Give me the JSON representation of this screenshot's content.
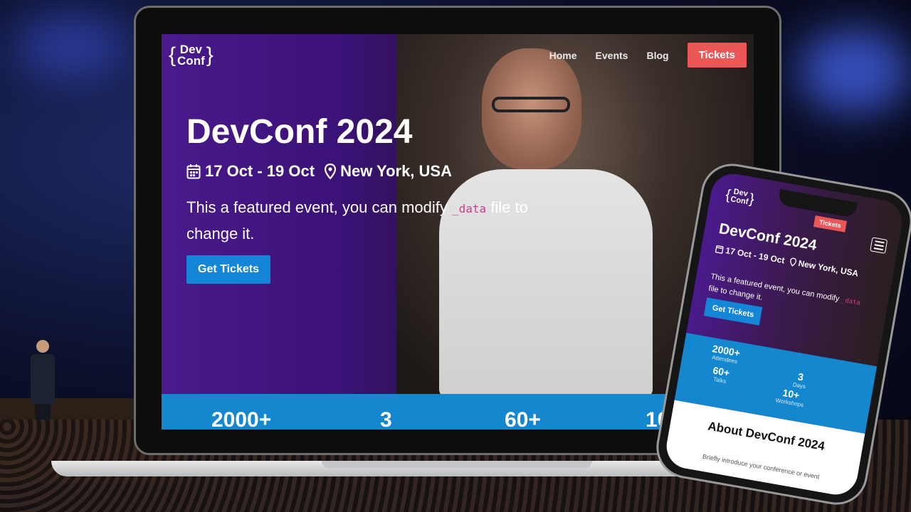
{
  "site": {
    "logo": {
      "line1": "Dev",
      "line2": "Conf",
      "brace_open": "{",
      "brace_close": "}"
    },
    "nav": {
      "home": "Home",
      "events": "Events",
      "blog": "Blog",
      "tickets": "Tickets"
    }
  },
  "hero": {
    "title": "DevConf 2024",
    "dates": "17 Oct - 19 Oct",
    "location": "New York, USA",
    "desc_before": "This a featured event, you can modify ",
    "desc_code": "_data",
    "desc_after": " file to change it.",
    "cta": "Get Tickets"
  },
  "stats": [
    {
      "value": "2000+",
      "label": "Attendees"
    },
    {
      "value": "3",
      "label": "Days"
    },
    {
      "value": "60+",
      "label": "Talks"
    },
    {
      "value": "10+",
      "label": "Workshops"
    }
  ],
  "about": {
    "title": "About DevConf 2024",
    "text": "Briefly introduce your conference or event"
  },
  "icons": {
    "calendar": "calendar-icon",
    "location": "map-pin-icon",
    "menu": "hamburger-menu-icon"
  },
  "colors": {
    "accent_red": "#eb5757",
    "accent_blue": "#1585d8",
    "stats_blue": "#1487cf",
    "code_pink": "#d03d8a",
    "hero_purple": "#4a1a8c"
  }
}
